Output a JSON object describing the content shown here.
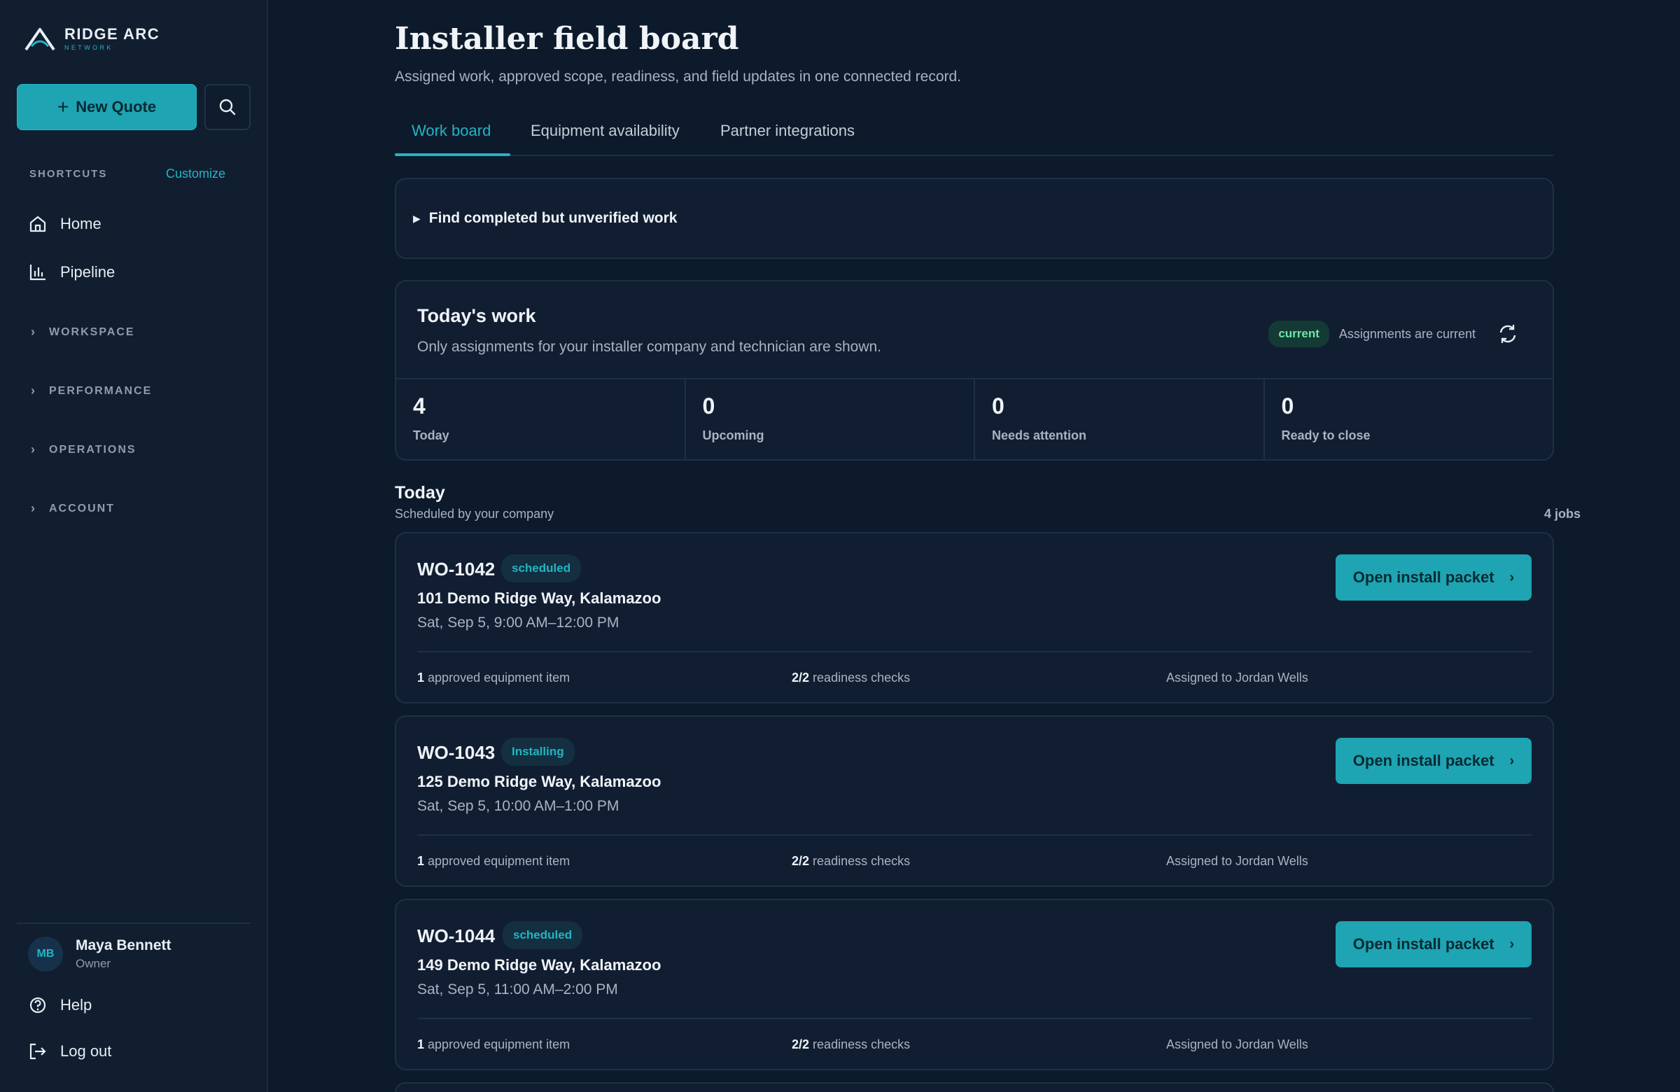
{
  "brand": {
    "name": "RIDGE ARC",
    "sub": "NETWORK"
  },
  "sidebar": {
    "new_quote_label": "New Quote",
    "shortcuts_title": "SHORTCUTS",
    "customize_label": "Customize",
    "nav": [
      {
        "label": "Home",
        "icon": "home-icon"
      },
      {
        "label": "Pipeline",
        "icon": "bar-chart-icon"
      }
    ],
    "sections": [
      "WORKSPACE",
      "PERFORMANCE",
      "OPERATIONS",
      "ACCOUNT"
    ],
    "user": {
      "initials": "MB",
      "name": "Maya Bennett",
      "role": "Owner"
    },
    "help_label": "Help",
    "logout_label": "Log out"
  },
  "header": {
    "title": "Installer field board",
    "subtitle": "Assigned work, approved scope, readiness, and field updates in one connected record."
  },
  "tabs": [
    {
      "label": "Work board",
      "active": true
    },
    {
      "label": "Equipment availability",
      "active": false
    },
    {
      "label": "Partner integrations",
      "active": false
    }
  ],
  "find_unverified": {
    "label": "Find completed but unverified work"
  },
  "todays_work": {
    "title": "Today's work",
    "subtitle": "Only assignments for your installer company and technician are shown.",
    "status_pill": "current",
    "status_text": "Assignments are current",
    "stats": [
      {
        "value": "4",
        "label": "Today"
      },
      {
        "value": "0",
        "label": "Upcoming"
      },
      {
        "value": "0",
        "label": "Needs attention"
      },
      {
        "value": "0",
        "label": "Ready to close"
      }
    ]
  },
  "today_section": {
    "title": "Today",
    "subtitle": "Scheduled by your company",
    "count": "4 jobs"
  },
  "jobs": [
    {
      "id": "WO-1042",
      "status": "scheduled",
      "address": "101 Demo Ridge Way, Kalamazoo",
      "time": "Sat, Sep 5, 9:00 AM–12:00 PM",
      "button": "Open install packet",
      "equipment_count": "1",
      "equipment_text": "approved equipment item",
      "readiness_count": "2/2",
      "readiness_text": "readiness checks",
      "assigned": "Assigned to Jordan Wells"
    },
    {
      "id": "WO-1043",
      "status": "Installing",
      "address": "125 Demo Ridge Way, Kalamazoo",
      "time": "Sat, Sep 5, 10:00 AM–1:00 PM",
      "button": "Open install packet",
      "equipment_count": "1",
      "equipment_text": "approved equipment item",
      "readiness_count": "2/2",
      "readiness_text": "readiness checks",
      "assigned": "Assigned to Jordan Wells"
    },
    {
      "id": "WO-1044",
      "status": "scheduled",
      "address": "149 Demo Ridge Way, Kalamazoo",
      "time": "Sat, Sep 5, 11:00 AM–2:00 PM",
      "button": "Open install packet",
      "equipment_count": "1",
      "equipment_text": "approved equipment item",
      "readiness_count": "2/2",
      "readiness_text": "readiness checks",
      "assigned": "Assigned to Jordan Wells"
    }
  ],
  "colors": {
    "accent": "#22b5c3",
    "background": "#0d1a2b",
    "panel": "#111e32",
    "success": "#6ee7a8"
  }
}
